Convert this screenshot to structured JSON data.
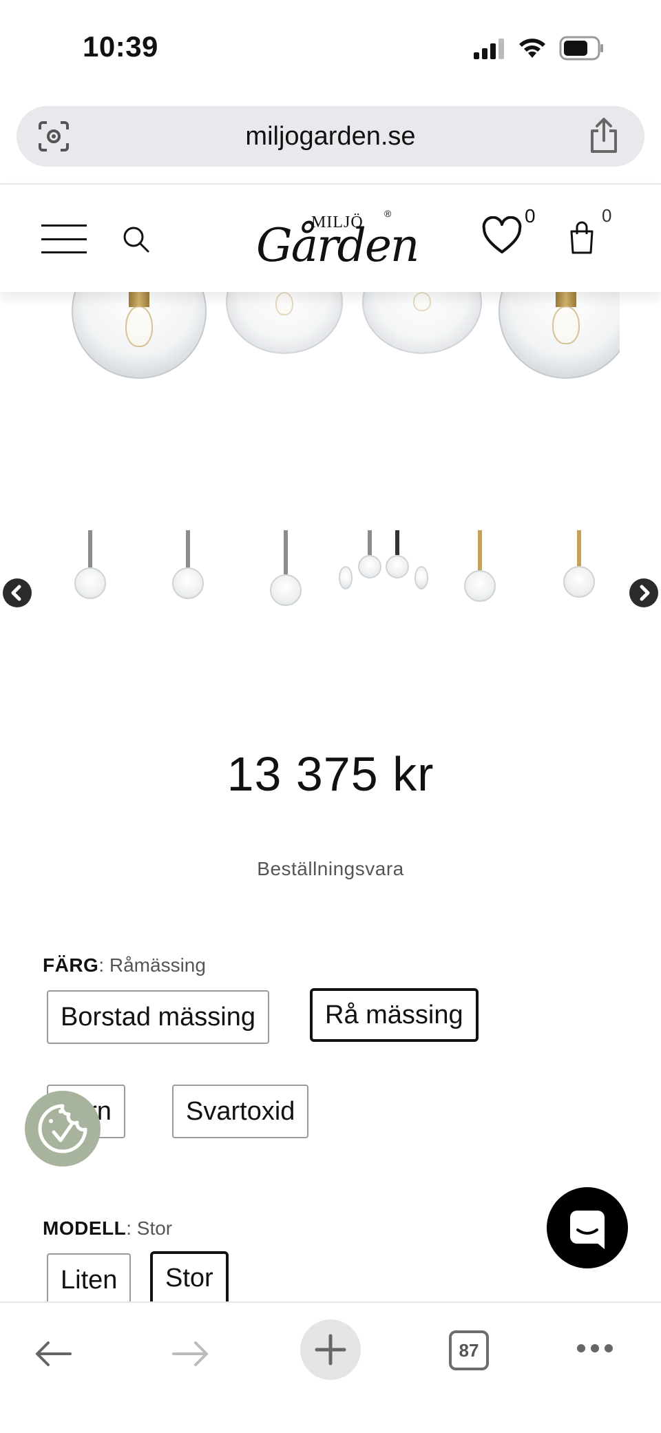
{
  "status": {
    "time": "10:39"
  },
  "browser": {
    "url": "miljogarden.se",
    "tab_count": "87"
  },
  "header": {
    "logo_small": "MILJÖ",
    "logo_large": "Gården",
    "logo_reg": "®",
    "wishlist_count": "0",
    "cart_count": "0"
  },
  "product": {
    "price": "13 375 kr",
    "availability": "Beställningsvara",
    "color_option": {
      "label": "FÄRG",
      "selected": "Råmässing",
      "options": [
        "Borstad mässing",
        "Rå mässing",
        "Järn",
        "Svartoxid"
      ]
    },
    "model_option": {
      "label": "MODELL",
      "selected": "Stor",
      "options": [
        "Liten",
        "Stor"
      ]
    }
  },
  "gallery": {
    "thumbnails": [
      "steel-pendant",
      "steel-pendant",
      "steel-pendant",
      "pendant-group",
      "brass-pendant",
      "brass-pendant"
    ]
  },
  "icons": {
    "menu": "menu-icon",
    "search": "search-icon",
    "wishlist": "heart-icon",
    "cart": "bag-icon",
    "prev": "chevron-left-icon",
    "next": "chevron-right-icon",
    "cookie": "cookie-icon",
    "chat": "chat-icon"
  },
  "colors": {
    "brand_text": "#111111",
    "cookie_bg": "#a7b39c",
    "chat_bg": "#000000",
    "url_bar": "#e7e9ec"
  }
}
